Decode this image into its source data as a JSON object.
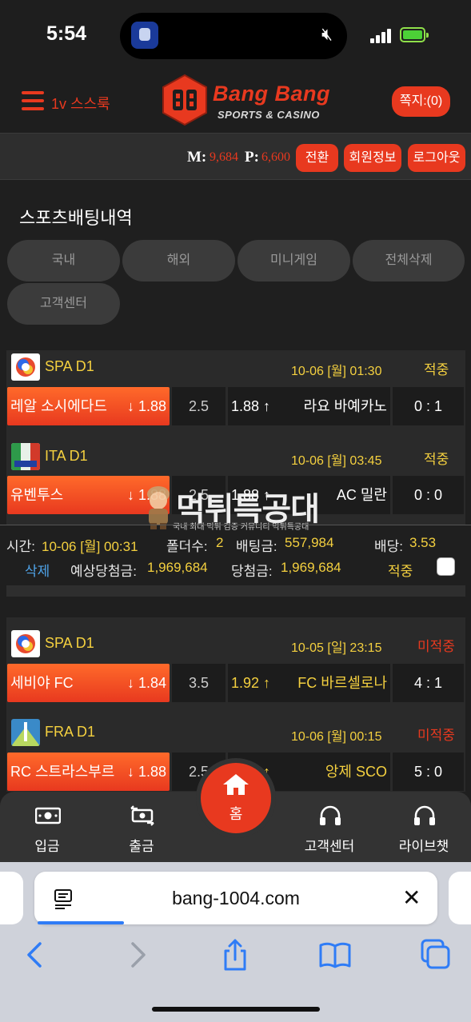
{
  "status_bar": {
    "time": "5:54"
  },
  "header": {
    "menu_text": "1v 스스룩",
    "logo_title": "Bang Bang",
    "logo_subtitle": "SPORTS & CASINO",
    "message_button": "쪽지:(0)"
  },
  "user_bar": {
    "money_label": "M:",
    "money_value": "9,684",
    "point_label": "P:",
    "point_value": "6,600",
    "buttons": [
      "전환",
      "회원정보",
      "로그아웃"
    ]
  },
  "page": {
    "title": "스포츠배팅내역",
    "tabs": [
      "국내",
      "해외",
      "미니게임",
      "전체삭제",
      "고객센터"
    ]
  },
  "bets": [
    {
      "matches": [
        {
          "league": "SPA D1",
          "datetime": "10-06 [월] 01:30",
          "status": "적중",
          "home": "레알 소시에다드",
          "home_odds": "↓ 1.88",
          "line": "2.5",
          "away_odds": "1.88 ↑",
          "away": "라요 바예카노",
          "score": "0 : 1"
        },
        {
          "league": "ITA D1",
          "datetime": "10-06 [월] 03:45",
          "status": "적중",
          "home": "유벤투스",
          "home_odds": "↓ 1.88",
          "line": "2.5",
          "away_odds": "1.88 ↑",
          "away": "AC 밀란",
          "score": "0 : 0"
        }
      ],
      "summary": {
        "time_label": "시간:",
        "time": "10-06 [월] 00:31",
        "folders_label": "폴더수:",
        "folders": "2",
        "amount_label": "배팅금:",
        "amount": "557,984",
        "odds_label": "배당:",
        "odds": "3.53",
        "delete_label": "삭제",
        "expected_label": "예상당첨금:",
        "expected": "1,969,684",
        "won_label": "당첨금:",
        "won": "1,969,684",
        "result": "적중"
      }
    },
    {
      "matches": [
        {
          "league": "SPA D1",
          "datetime": "10-05 [일] 23:15",
          "status": "미적중",
          "home": "세비야 FC",
          "home_odds": "↓ 1.84",
          "line": "3.5",
          "away_odds": "1.92 ↑",
          "away": "FC 바르셀로나",
          "score": "4 : 1"
        },
        {
          "league": "FRA D1",
          "datetime": "10-06 [월] 00:15",
          "status": "미적중",
          "home": "RC 스트라스부르",
          "home_odds": "↓ 1.88",
          "line": "2.5",
          "away_odds": "1.88 ↑",
          "away": "앙제 SCO",
          "score": "5 : 0"
        }
      ]
    }
  ],
  "watermark": {
    "title": "먹튀특공대",
    "subtitle": "국내 최대 먹튀 검증 커뮤니티 먹튀특공대"
  },
  "bottom_nav": {
    "deposit": "입금",
    "withdraw": "출금",
    "home": "홈",
    "support": "고객센터",
    "livechat": "라이브챗"
  },
  "browser": {
    "url": "bang-1004.com"
  },
  "colors": {
    "accent": "#e8391f",
    "gold": "#f4d03f",
    "win": "#f4d03f",
    "lose": "#e8391f"
  }
}
